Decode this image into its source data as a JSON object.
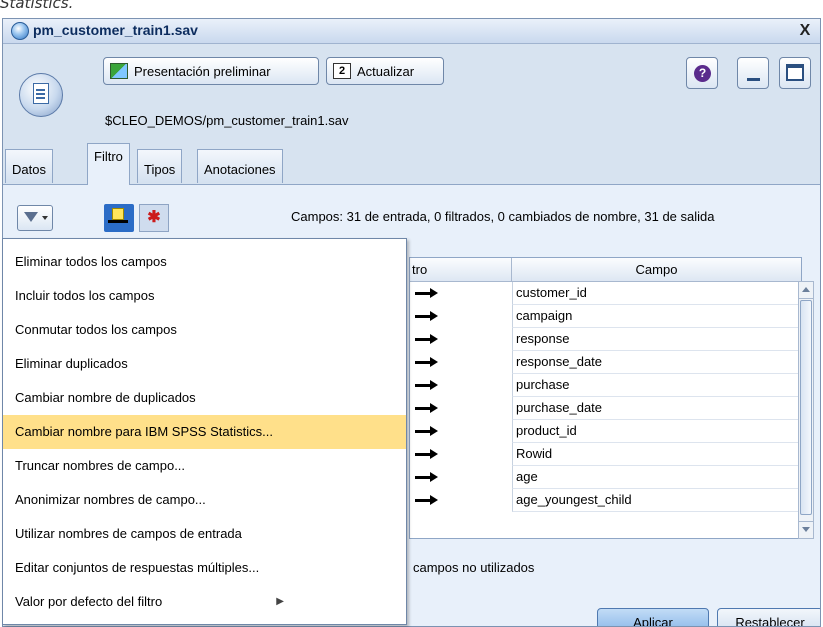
{
  "caption": "Statistics.",
  "window": {
    "title": "pm_customer_train1.sav",
    "close_glyph": "X",
    "icon": "database-globe-icon"
  },
  "toolbar": {
    "preview_label": "Presentación preliminar",
    "preview_underline": "P",
    "refresh_label": "Actualizar",
    "help_glyph": "?"
  },
  "path": "$CLEO_DEMOS/pm_customer_train1.sav",
  "tabs": [
    {
      "label": "Datos",
      "active": false
    },
    {
      "label": "Filtro",
      "active": true
    },
    {
      "label": "Tipos",
      "active": false
    },
    {
      "label": "Anotaciones",
      "active": false
    }
  ],
  "filter": {
    "summary": "Campos: 31 de entrada, 0 filtrados, 0 cambiados de nombre, 31 de salida",
    "grid_header_filter": "tro",
    "grid_header_field": "Campo",
    "fields": [
      "customer_id",
      "campaign",
      "response",
      "response_date",
      "purchase",
      "purchase_date",
      "product_id",
      "Rowid",
      "age",
      "age_youngest_child"
    ],
    "unused_text": "campos no utilizados"
  },
  "menu": {
    "items": [
      "Eliminar todos los campos",
      "Incluir todos los campos",
      "Conmutar todos los campos",
      "Eliminar duplicados",
      "Cambiar nombre de duplicados",
      "Cambiar nombre para IBM SPSS Statistics...",
      "Truncar nombres de campo...",
      "Anonimizar nombres de campo...",
      "Utilizar nombres de campos de entrada",
      "Editar conjuntos de respuestas múltiples...",
      "Valor por defecto del filtro"
    ],
    "highlighted_index": 5,
    "submenu_index": 10,
    "highlight_color": "#ffe08a"
  },
  "buttons": {
    "apply": "Aplicar",
    "reset": "Restablecer"
  },
  "colors": {
    "panel": "#e8f0fa",
    "title_text": "#0c2c5e",
    "apply_button": "#7fb0e6"
  }
}
